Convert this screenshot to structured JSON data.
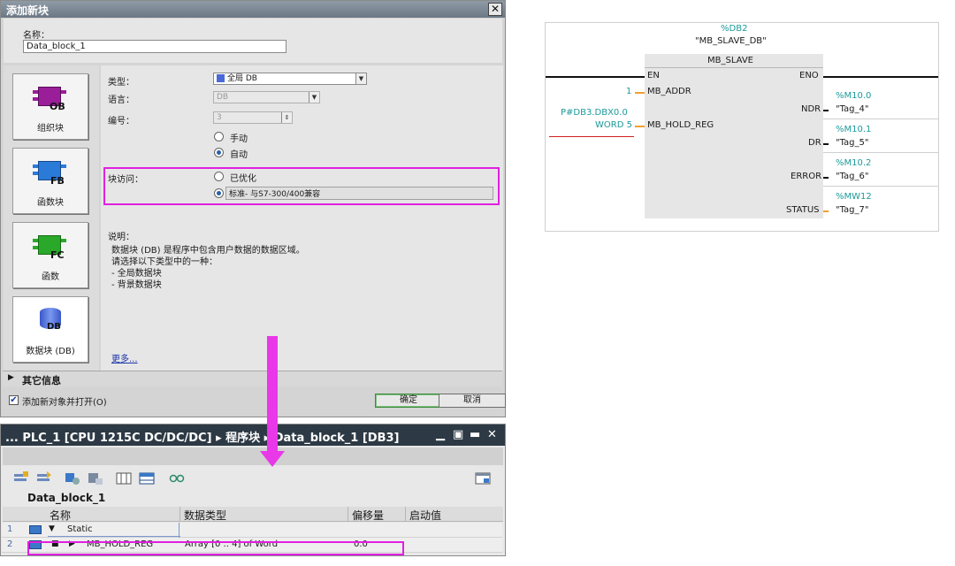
{
  "dialog": {
    "title": "添加新块",
    "close_glyph": "✕",
    "name_label": "名称：",
    "name_value": "Data_block_1",
    "block_types": [
      {
        "code": "OB",
        "label": "组织块",
        "color": "#9a1e9a"
      },
      {
        "code": "FB",
        "label": "函数块",
        "color": "#2a7ad8"
      },
      {
        "code": "FC",
        "label": "函数",
        "color": "#2aa82a"
      },
      {
        "code": "DB",
        "label": "数据块 (DB)",
        "color": "#4a6ad8"
      }
    ],
    "type_label": "类型：",
    "type_value": "全局 DB",
    "language_label": "语言：",
    "language_value": "DB",
    "number_label": "编号：",
    "number_value": "3",
    "manual_label": "手动",
    "auto_label": "自动",
    "access_label": "块访问：",
    "optimized_label": "已优化",
    "standard_label": "标准- 与S7-300/400兼容",
    "desc_title": "说明：",
    "desc_lines": [
      "数据块 (DB) 是程序中包含用户数据的数据区域。",
      "请选择以下类型中的一种：",
      "- 全局数据块",
      "- 背景数据块"
    ],
    "more_link": "更多...",
    "other_info": "其它信息",
    "add_open_label": "添加新对象并打开(O)",
    "ok_button": "确定",
    "cancel_button": "取消",
    "add_open_checked": true,
    "access_mode": "standard",
    "numbering": "auto"
  },
  "editor": {
    "breadcrumb": "... PLC_1 [CPU 1215C DC/DC/DC]  ▸  程序块  ▸  Data_block_1 [DB3]",
    "db_name": "Data_block_1",
    "columns": [
      "名称",
      "数据类型",
      "偏移量",
      "启动值"
    ],
    "rows": [
      {
        "num": "1",
        "name": "Static",
        "type": "",
        "offset": "",
        "start": ""
      },
      {
        "num": "2",
        "name": "MB_HOLD_REG",
        "type": "Array [0 .. 4] of Word",
        "offset": "0.0",
        "start": ""
      }
    ],
    "win_controls": [
      "▁",
      "▣",
      "▬",
      "✕"
    ]
  },
  "ladder": {
    "instance_db": "%DB2",
    "instance_name": "\"MB_SLAVE_DB\"",
    "fb_name": "MB_SLAVE",
    "en": "EN",
    "eno": "ENO",
    "inputs": [
      {
        "value": "1",
        "pin": "MB_ADDR"
      },
      {
        "value": "P#DB3.DBX0.0\nWORD 5",
        "value1": "P#DB3.DBX0.0",
        "value2": "WORD 5",
        "pin": "MB_HOLD_REG"
      }
    ],
    "outputs": [
      {
        "pin": "NDR",
        "addr": "%M10.0",
        "tag": "\"Tag_4\""
      },
      {
        "pin": "DR",
        "addr": "%M10.1",
        "tag": "\"Tag_5\""
      },
      {
        "pin": "ERROR",
        "addr": "%M10.2",
        "tag": "\"Tag_6\""
      },
      {
        "pin": "STATUS",
        "addr": "%MW12",
        "tag": "\"Tag_7\""
      }
    ]
  },
  "colors": {
    "highlight": "#e020e0",
    "arrow": "#e838e8",
    "teal": "#1d9a9a"
  }
}
